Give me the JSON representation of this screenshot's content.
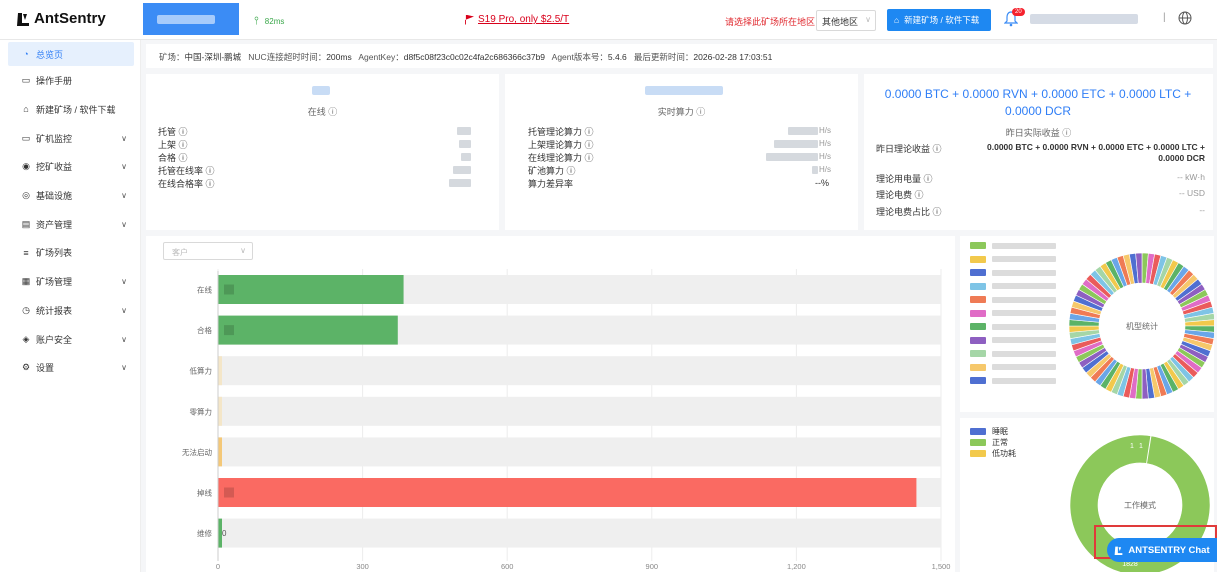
{
  "app": {
    "name": "AntSentry"
  },
  "topbar": {
    "ping": "82ms",
    "promo": "S19 Pro, only $2.5/T",
    "region_prompt": "请选择此矿场所在地区：",
    "region_value": "其他地区",
    "new_button": "新建矿场 / 软件下载",
    "notification_count": "20",
    "separator": "|"
  },
  "sidebar": {
    "items": [
      {
        "label": "总览页",
        "icon": "dashboard-icon",
        "active": true
      },
      {
        "label": "操作手册",
        "icon": "book-icon"
      },
      {
        "label": "新建矿场 / 软件下载",
        "icon": "bank-icon"
      },
      {
        "label": "矿机监控",
        "icon": "monitor-icon",
        "has_children": true
      },
      {
        "label": "挖矿收益",
        "icon": "coin-icon",
        "has_children": true
      },
      {
        "label": "基础设施",
        "icon": "wifi-icon",
        "has_children": true
      },
      {
        "label": "资产管理",
        "icon": "database-icon",
        "has_children": true
      },
      {
        "label": "矿场列表",
        "icon": "list-icon"
      },
      {
        "label": "矿场管理",
        "icon": "calendar-icon",
        "has_children": true
      },
      {
        "label": "统计报表",
        "icon": "clock-icon",
        "has_children": true
      },
      {
        "label": "账户安全",
        "icon": "shield-icon",
        "has_children": true
      },
      {
        "label": "设置",
        "icon": "gear-icon",
        "has_children": true
      }
    ]
  },
  "infobar": {
    "site_label": "矿场：",
    "site_value": "中国-深圳-鹏城",
    "nuc_label": "NUC连接超时时间：",
    "nuc_value": "200ms",
    "agentkey_label": "AgentKey：",
    "agentkey_value": "d8f5c08f23c0c02c4fa2c686366c37b9",
    "agent_ver_label": "Agent版本号：",
    "agent_ver_value": "5.4.6",
    "updated_label": "最后更新时间：",
    "updated_value": "2026-02-28 17:03:51"
  },
  "card_online": {
    "subtitle": "在线",
    "rows": [
      "托管",
      "上架",
      "合格",
      "托管在线率",
      "在线合格率"
    ]
  },
  "card_hashrate": {
    "subtitle": "实时算力",
    "rows": [
      {
        "label": "托管理论算力",
        "unit": "H/s"
      },
      {
        "label": "上架理论算力",
        "unit": "H/s"
      },
      {
        "label": "在线理论算力",
        "unit": "H/s"
      },
      {
        "label": "矿池算力",
        "unit": "H/s"
      },
      {
        "label": "算力差异率",
        "unit": "--%"
      }
    ]
  },
  "card_income": {
    "line1": "0.0000 BTC + 0.0000 RVN + 0.0000 ETC + 0.0000 LTC +",
    "line2": "0.0000 DCR",
    "subtitle": "昨日实际收益",
    "rows": [
      {
        "label": "昨日理论收益",
        "value": "0.0000 BTC + 0.0000 RVN + 0.0000 ETC + 0.0000 LTC +",
        "value2": "0.0000 DCR"
      },
      {
        "label": "理论用电量",
        "value": "-- kW·h"
      },
      {
        "label": "理论电费",
        "value": "-- USD"
      },
      {
        "label": "理论电费占比",
        "value": "--"
      }
    ]
  },
  "filter": {
    "placeholder": "客户"
  },
  "chart_data": {
    "type": "bar",
    "orientation": "horizontal",
    "categories": [
      "在线",
      "合格",
      "低算力",
      "零算力",
      "无法启动",
      "掉线",
      "维修"
    ],
    "values": [
      385,
      373,
      0,
      0,
      0,
      1449,
      0
    ],
    "value_labels": [
      "",
      "",
      "",
      "",
      "",
      "",
      "0"
    ],
    "colors": [
      "#5cb367",
      "#5cb367",
      "#f4e6c8",
      "#f4e6c8",
      "#f4c878",
      "#fa6a62",
      "#5cb367"
    ],
    "xlim": [
      0,
      1500
    ],
    "xticks": [
      0,
      300,
      600,
      900,
      1200,
      1500
    ],
    "xtick_labels": [
      "0",
      "300",
      "600",
      "900",
      "1,200",
      "1,500"
    ],
    "grid": true
  },
  "donut_models": {
    "center_label": "机型统计"
  },
  "donut_mode": {
    "center_label": "工作模式",
    "legend": [
      {
        "label": "睡眠",
        "color": "#4f6fd1"
      },
      {
        "label": "正常",
        "color": "#8cc85a"
      },
      {
        "label": "低功耗",
        "color": "#f2c94c"
      }
    ],
    "segments": [
      {
        "label": "睡眠",
        "value": 1,
        "color": "#4f6fd1"
      },
      {
        "label": "低功耗",
        "value": 1,
        "color": "#f2c94c"
      },
      {
        "label": "正常",
        "value": 1828,
        "color": "#8cc85a"
      }
    ],
    "bottom_value": "1828"
  },
  "chat": {
    "label": "ANTSENTRY Chat"
  }
}
